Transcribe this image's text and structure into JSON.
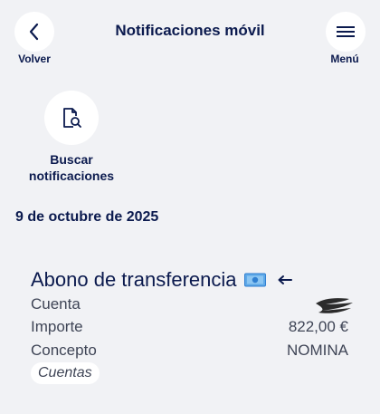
{
  "header": {
    "title": "Notificaciones móvil",
    "back_label": "Volver",
    "menu_label": "Menú"
  },
  "search": {
    "label_line1": "Buscar",
    "label_line2": "notificaciones",
    "icon": "document-search-icon"
  },
  "date": "9 de octubre de 2025",
  "notification": {
    "title": "Abono de transferencia",
    "title_icon": "money-icon",
    "indicator_icon": "arrow-left-icon",
    "fields": [
      {
        "label": "Cuenta",
        "value": ""
      },
      {
        "label": "Importe",
        "value": "822,00 €"
      },
      {
        "label": "Concepto",
        "value": "NOMINA"
      }
    ],
    "tag": "Cuentas"
  },
  "colors": {
    "primary": "#0b1a4e",
    "background": "#f1f2f5",
    "secondary_text": "#3f4556"
  }
}
